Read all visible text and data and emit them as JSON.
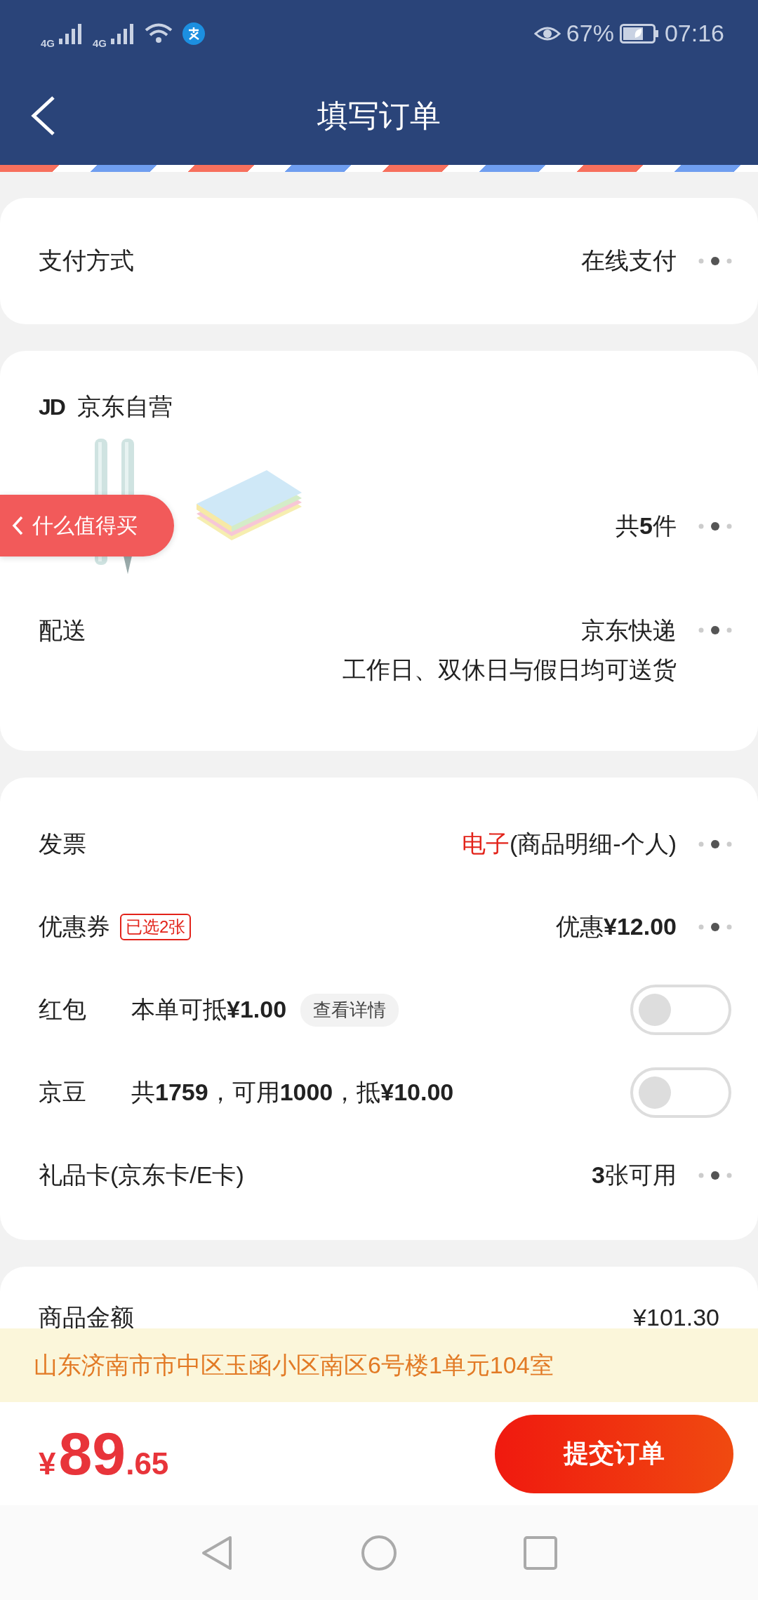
{
  "status_bar": {
    "signals": [
      "4G",
      "4G"
    ],
    "battery": "67%",
    "time": "07:16"
  },
  "header": {
    "title": "填写订单"
  },
  "payment": {
    "label": "支付方式",
    "value": "在线支付"
  },
  "store": {
    "badge": "JD",
    "name": "京东自营",
    "count": "共**5**件",
    "delivery": {
      "label": "配送",
      "lines": [
        "京东快递",
        "工作日、双休日与假日均可送货"
      ]
    }
  },
  "floating_button": {
    "label": "什么值得买"
  },
  "options": [
    {
      "kind": "arrow",
      "label": "发票",
      "highlight": "电子",
      "value": "(商品明细-个人)"
    },
    {
      "kind": "arrow",
      "label": "优惠券",
      "tag": "已选2张",
      "value": "优惠**¥12.00**"
    },
    {
      "kind": "toggle",
      "label": "红包",
      "text": "本单可抵**¥1.00**",
      "button": "查看详情",
      "on": false
    },
    {
      "kind": "toggle",
      "label": "京豆",
      "text": "共**1759**，可用**1000**，抵**¥10.00**",
      "on": false
    },
    {
      "kind": "arrow",
      "label": "礼品卡(京东卡/E卡)",
      "value": "**3**张可用"
    }
  ],
  "summary": {
    "label": "商品金额",
    "value": "¥101.30"
  },
  "address": "山东济南市市中区玉函小区南区6号楼1单元104室",
  "total": {
    "currency": "¥",
    "integer": "89",
    "decimal": ".65"
  },
  "submit": "提交订单"
}
